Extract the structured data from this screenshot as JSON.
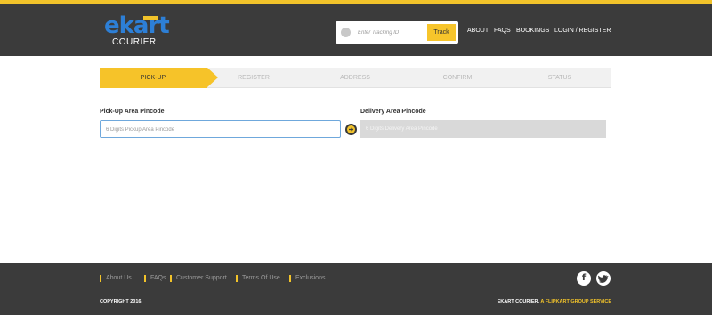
{
  "brand": {
    "logo_main": "ekart",
    "logo_sub": "COURIER"
  },
  "tracking": {
    "placeholder": "Enter Tracking ID",
    "button_label": "Track"
  },
  "nav": {
    "about": "ABOUT",
    "faqs": "FAQS",
    "bookings": "BOOKINGS",
    "login": "LOGIN / REGISTER"
  },
  "steps": [
    "PICK-UP",
    "REGISTER",
    "ADDRESS",
    "CONFIRM",
    "STATUS"
  ],
  "form": {
    "pickup_label": "Pick-Up Area Pincode",
    "pickup_placeholder": "6 Digits Pickup Area Pincode",
    "delivery_label": "Delivery Area Pincode",
    "delivery_placeholder": "6 Digits Delivery Area Pincode"
  },
  "footer": {
    "links": [
      "About Us",
      "FAQs",
      "Customer Support",
      "Terms Of Use",
      "Exclusions"
    ],
    "copyright": "COPYRIGHT 2016.",
    "tagline_prefix": "EKART COURIER. ",
    "tagline_highlight": "A FLIPKART GROUP SERVICE",
    "social_facebook": "f",
    "social_twitter": "t"
  },
  "colors": {
    "accent": "#f2c32a",
    "header_bg": "#3b3b3b",
    "logo_blue": "#2d7fd6"
  }
}
